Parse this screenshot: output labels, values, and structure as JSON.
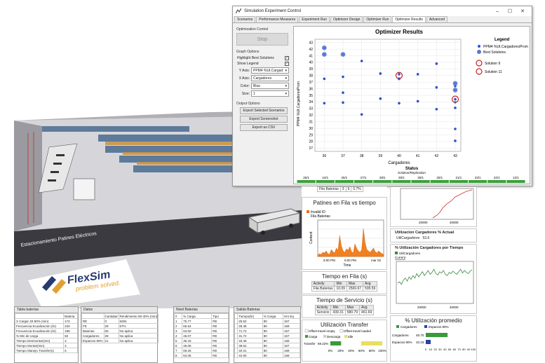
{
  "window": {
    "title": "Simulation Experiment Control",
    "tabs": [
      "Scenarios",
      "Performance Measures",
      "Experiment Run",
      "Optimizer Design",
      "Optimizer Run",
      "Optimizer Results",
      "Advanced"
    ],
    "controls": [
      "–",
      "☐",
      "✕"
    ]
  },
  "optimizer_control": {
    "group_label": "Optimization Control",
    "stop_label": "Stop",
    "graph_options_label": "Graph Options",
    "highlight_best": "Highlight Best Solutions",
    "show_legend": "Show Legend",
    "y_axis_label": "Y Axis:",
    "y_axis_value": "PPM4 %Ut.Cargad",
    "x_axis_label": "X Axis:",
    "x_axis_value": "Cargadores",
    "color_label": "Color:",
    "color_value": "Blue",
    "size_label": "Size:",
    "size_value": "1",
    "output_options_label": "Output Options",
    "export_selected": "Export Selected Scenarios",
    "export_screenshot": "Export Screenshot",
    "export_csv": "Export as CSV"
  },
  "chart_data": {
    "type": "scatter",
    "title": "Optimizer Results",
    "xlabel": "Cargadores",
    "ylabel": "PPM4 %Ut.CargadoresProm",
    "x_ticks": [
      "36",
      "37",
      "38",
      "39",
      "40",
      "41",
      "42",
      "43"
    ],
    "y_ticks": [
      "27",
      "28",
      "29",
      "30",
      "31",
      "32",
      "33",
      "34",
      "35",
      "36",
      "37",
      "38",
      "39",
      "40",
      "41",
      "42",
      "43"
    ],
    "xlim": [
      35.5,
      43.3
    ],
    "ylim": [
      26.5,
      43.5
    ],
    "series": [
      {
        "name": "PPM4 %Ut.CargadoresProm",
        "color": "#3050c8",
        "points": [
          [
            36,
            42.2
          ],
          [
            36,
            41.2
          ],
          [
            36,
            37.5
          ],
          [
            36,
            33.8
          ],
          [
            37,
            41.2
          ],
          [
            37,
            37.8
          ],
          [
            37,
            35.4
          ],
          [
            37,
            33.9
          ],
          [
            38,
            40.2
          ],
          [
            38,
            32.1
          ],
          [
            39,
            38.3
          ],
          [
            39,
            34.5
          ],
          [
            40,
            38.2
          ],
          [
            40,
            37.5
          ],
          [
            40,
            33.8
          ],
          [
            41,
            38.2
          ],
          [
            41,
            34.1
          ],
          [
            42,
            39.8
          ],
          [
            42,
            36.2
          ],
          [
            42,
            32.9
          ],
          [
            43,
            36.8
          ],
          [
            43,
            36.4
          ],
          [
            43,
            35.8
          ],
          [
            43,
            34.4
          ],
          [
            43,
            33.1
          ],
          [
            43,
            29.9
          ],
          [
            43,
            28.1
          ]
        ]
      },
      {
        "name": "Best Solutions",
        "color": "#5878d8",
        "points": [
          [
            36,
            42.2
          ],
          [
            36,
            41.2
          ],
          [
            37,
            41.2
          ],
          [
            43,
            36.8
          ],
          [
            43,
            35.8
          ]
        ]
      }
    ],
    "solutions": [
      {
        "name": "Solution 9",
        "x": 40,
        "y": 38.0
      },
      {
        "name": "Solution 11",
        "x": 43,
        "y": 34.4
      }
    ],
    "legend_title": "Legend",
    "legend_position": "right"
  },
  "status": {
    "title": "Status",
    "subtitle": "Solution/Replication",
    "items": [
      "25/1",
      "24/1",
      "26/1",
      "27/1",
      "28/1",
      "29/1",
      "30/1",
      "20/1",
      "21/1",
      "23/1",
      "22/1",
      "12/1"
    ]
  },
  "fila_small": {
    "label": "Fila Baterias",
    "v1": "3",
    "v2": "6",
    "v3": "0.7%"
  },
  "patines": {
    "title": "Patines en Fila vs tiempo",
    "legend1": "Invalid ID",
    "legend2": "Fila Baterias",
    "ylabel": "Content",
    "xlabel": "Time",
    "xticks": [
      "5:00 PM",
      "mar 02"
    ],
    "tick_mid": "6:00 PM"
  },
  "tiempo_fila": {
    "title": "Tiempo en Fila (s)",
    "headers": [
      "Activity",
      "Min",
      "Max",
      "Avg"
    ],
    "row": [
      "Fila Baterias",
      "10.09",
      "2569.67",
      "595.59"
    ]
  },
  "tiempo_servicio": {
    "title": "Tiempo de Servicio (s)",
    "headers": [
      "Activity",
      "Min",
      "Max",
      "Avg"
    ],
    "row": [
      "Servicio",
      "439.31",
      "580.79",
      "461.69"
    ]
  },
  "utilizacion_transfer": {
    "title": "Utilización Transfer",
    "legend": [
      "Offset travel empty",
      "Offset travel loaded",
      "Carga",
      "Descarga",
      "Idle"
    ],
    "row_label": "Transfer",
    "row_value": "59.22%",
    "axis": [
      "0%",
      "20%",
      "40%",
      "60%",
      "80%",
      "100%"
    ],
    "colors": {
      "carga": "#3a9a3a",
      "descarga": "#cfcfcf",
      "idle": "#e8e060"
    }
  },
  "top_right_chart": {
    "ticks": [
      "20000",
      "40000"
    ]
  },
  "util_actual": {
    "title": "Utilizacion Cargadores % Actual",
    "label": "UtilCargadores",
    "value": "53.6"
  },
  "util_tiempo": {
    "title": "% Utilización Cargadores por Tiempo",
    "legend": "UtilCargadores",
    "current": "Current",
    "ticks": [
      "20000",
      "40000"
    ]
  },
  "util_promedio": {
    "title": "% Utilización promedio",
    "legend": [
      "Cargadores",
      "Espacios 80%"
    ],
    "rows": [
      {
        "label": "Cargadores",
        "value": "45.70",
        "pct": 45.7
      },
      {
        "label": "Espacios 80%",
        "value": "10.23",
        "pct": 10.23
      }
    ],
    "axis": [
      "0",
      "10",
      "20",
      "30",
      "40",
      "50",
      "60",
      "70",
      "80",
      "90",
      "100"
    ]
  },
  "scene": {
    "floor_label": "Estacionamiento Patines Eléctricos",
    "logo_text": "FlexSim",
    "logo_tagline": "problem solved."
  },
  "bottom_windows": [
    {
      "title": "Tabla baterias",
      "rows": [
        [
          "",
          "Bateria"
        ],
        [
          "X Cargar 40-80% (min)",
          "174"
        ],
        [
          "Frecuencia Ecualización (hr)",
          "240"
        ],
        [
          "Frecuencia Ecualización (hr)",
          "168"
        ],
        [
          "% Min de carga",
          "50"
        ],
        [
          "Tiempo Desmontar(min)",
          "3"
        ],
        [
          "Tiempo Montar(min)",
          "3"
        ],
        [
          "Tiempo Manejo Transfer(s)",
          "6"
        ]
      ]
    },
    {
      "title": "Datos",
      "rows": [
        [
          "",
          "Cantidad",
          "Rendimiento 80-40% (min)"
        ],
        [
          "RE",
          "0",
          "6284"
        ],
        [
          "FE",
          "29",
          "57%"
        ],
        [
          "Baterias",
          "60",
          "No aplica"
        ],
        [
          "Cargadores",
          "28",
          "No aplica"
        ],
        [
          "Espacios 80%",
          "21",
          "No aplica"
        ]
      ]
    },
    {
      "title": "Nivel Baterias",
      "rows": [
        [
          "#",
          "% Carga",
          "Tipo"
        ],
        [
          "1",
          "75.77",
          "RE"
        ],
        [
          "2",
          "65.54",
          "RE"
        ],
        [
          "3",
          "63.60",
          "RE"
        ],
        [
          "4",
          "46.07",
          "RE"
        ],
        [
          "5",
          "35.43",
          "RE"
        ],
        [
          "6",
          "46.06",
          "RE"
        ],
        [
          "7",
          "69.25",
          "RE"
        ],
        [
          "8",
          "62.05",
          "RE"
        ]
      ]
    },
    {
      "title": "Salida Baterias",
      "rows": [
        [
          "",
          "Tiempo(hr)",
          "% Carga",
          "Hrs Eq"
        ],
        [
          "",
          "25.62",
          "80",
          "167"
        ],
        [
          "",
          "28.35",
          "80",
          "169"
        ],
        [
          "",
          "71.72",
          "80",
          "167"
        ],
        [
          "",
          "31.72",
          "80",
          "167"
        ],
        [
          "",
          "40.48",
          "80",
          "168"
        ],
        [
          "",
          "38.62",
          "80",
          "167"
        ],
        [
          "",
          "40.31",
          "80",
          "168"
        ],
        [
          "",
          "42.90",
          "80",
          "168"
        ]
      ]
    }
  ]
}
